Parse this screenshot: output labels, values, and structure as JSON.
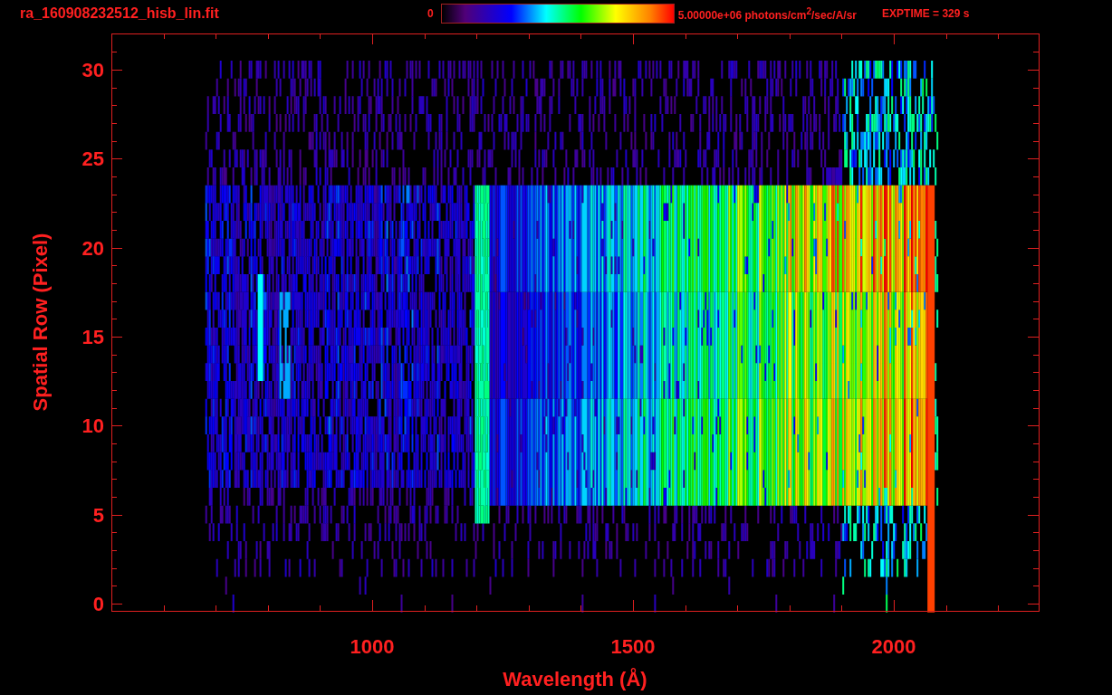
{
  "title": "ra_160908232512_hisb_lin.fit",
  "colorbar": {
    "min_label": "0",
    "max_label": "5.00000e+06 photons/cm$^{2}$/sec/A/sr"
  },
  "exposure": "EXPTIME = 329 s",
  "plot": {
    "xlabel": "Wavelength (Å)",
    "ylabel": "Spatial Row (Pixel)",
    "xtick_labels": [
      "1000",
      "1500",
      "2000"
    ],
    "ytick_labels": [
      "30",
      "25",
      "20",
      "15",
      "10",
      "5",
      "0"
    ]
  }
}
